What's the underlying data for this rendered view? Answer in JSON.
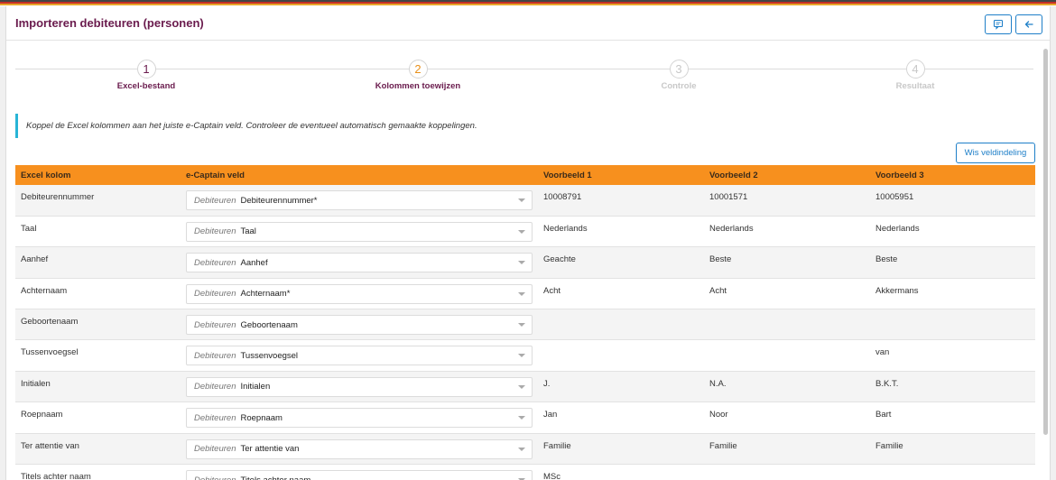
{
  "header": {
    "title": "Importeren debiteuren (personen)"
  },
  "steps": [
    {
      "num": "1",
      "label": "Excel-bestand"
    },
    {
      "num": "2",
      "label": "Kolommen toewijzen"
    },
    {
      "num": "3",
      "label": "Controle"
    },
    {
      "num": "4",
      "label": "Resultaat"
    }
  ],
  "info_text": "Koppel de Excel kolommen aan het juiste e-Captain veld. Controleer de eventueel automatisch gemaakte koppelingen.",
  "wis_button": "Wis veldindeling",
  "table": {
    "headers": [
      "Excel kolom",
      "e-Captain veld",
      "Voorbeeld 1",
      "Voorbeeld 2",
      "Voorbeeld 3"
    ],
    "select_prefix": "Debiteuren",
    "rows": [
      {
        "col": "Debiteurennummer",
        "field": "Debiteurennummer*",
        "v1": "10008791",
        "v2": "10001571",
        "v3": "10005951"
      },
      {
        "col": "Taal",
        "field": "Taal",
        "v1": "Nederlands",
        "v2": "Nederlands",
        "v3": "Nederlands"
      },
      {
        "col": "Aanhef",
        "field": "Aanhef",
        "v1": "Geachte",
        "v2": "Beste",
        "v3": "Beste"
      },
      {
        "col": "Achternaam",
        "field": "Achternaam*",
        "v1": "Acht",
        "v2": "Acht",
        "v3": "Akkermans"
      },
      {
        "col": "Geboortenaam",
        "field": "Geboortenaam",
        "v1": "",
        "v2": "",
        "v3": ""
      },
      {
        "col": "Tussenvoegsel",
        "field": "Tussenvoegsel",
        "v1": "",
        "v2": "",
        "v3": "van"
      },
      {
        "col": "Initialen",
        "field": "Initialen",
        "v1": "J.",
        "v2": "N.A.",
        "v3": "B.K.T."
      },
      {
        "col": "Roepnaam",
        "field": "Roepnaam",
        "v1": "Jan",
        "v2": "Noor",
        "v3": "Bart"
      },
      {
        "col": "Ter attentie van",
        "field": "Ter attentie van",
        "v1": "Familie",
        "v2": "Familie",
        "v3": "Familie"
      },
      {
        "col": "Titels achter naam",
        "field": "Titels achter naam",
        "v1": "MSc",
        "v2": "",
        "v3": ""
      }
    ]
  }
}
